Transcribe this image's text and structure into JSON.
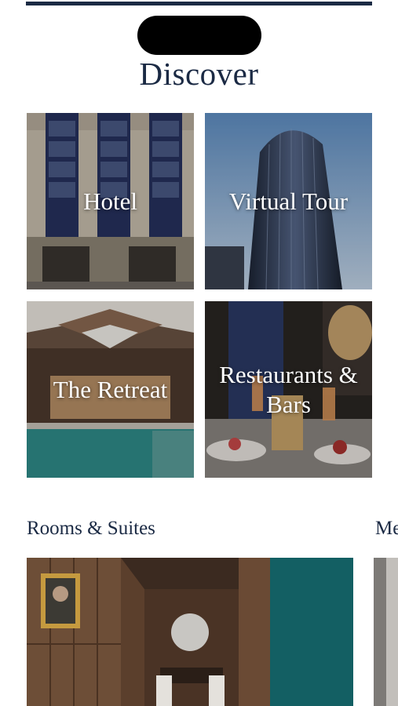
{
  "page": {
    "title": "Discover"
  },
  "tiles": [
    {
      "label": "Hotel"
    },
    {
      "label": "Virtual Tour"
    },
    {
      "label": "The Retreat"
    },
    {
      "label": "Restaurants & Bars"
    }
  ],
  "sections": {
    "rooms_title": "Rooms & Suites",
    "next_title_partial": "Me"
  },
  "colors": {
    "navy": "#1b2a44",
    "background": "#ffffff"
  }
}
